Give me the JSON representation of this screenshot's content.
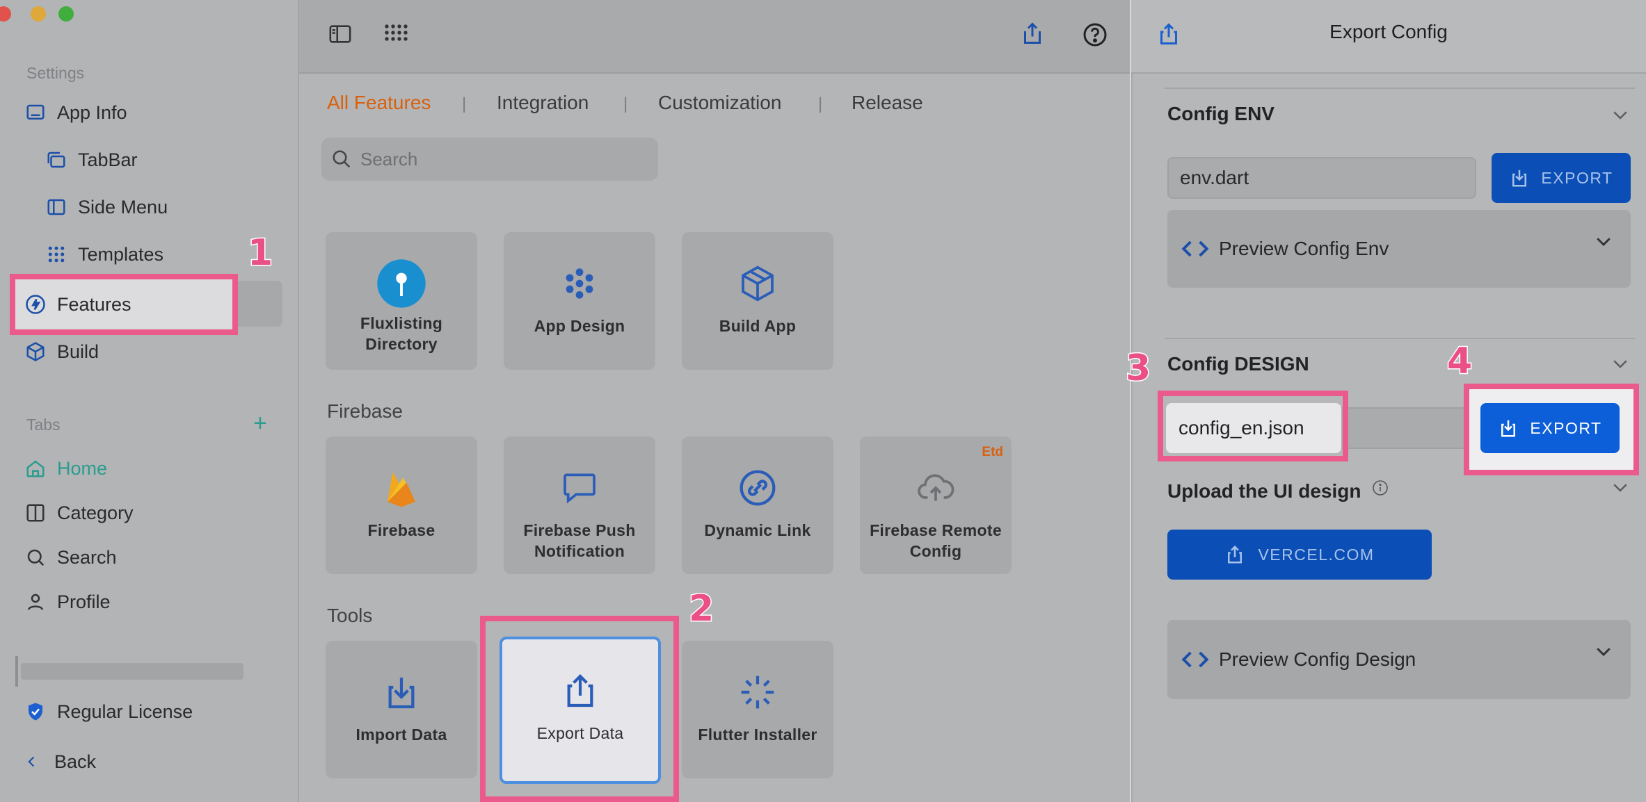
{
  "sidebar": {
    "settings_label": "Settings",
    "items": [
      {
        "label": "App Info",
        "icon": "monitor-icon"
      },
      {
        "label": "TabBar",
        "icon": "tabbar-icon"
      },
      {
        "label": "Side Menu",
        "icon": "side-menu-icon"
      },
      {
        "label": "Templates",
        "icon": "grid-icon"
      },
      {
        "label": "Features",
        "icon": "bolt-icon"
      },
      {
        "label": "Build",
        "icon": "cube-icon"
      }
    ],
    "tabs_label": "Tabs",
    "tabs": [
      {
        "label": "Home",
        "icon": "home-icon"
      },
      {
        "label": "Category",
        "icon": "columns-icon"
      },
      {
        "label": "Search",
        "icon": "search-icon"
      },
      {
        "label": "Profile",
        "icon": "user-icon"
      }
    ],
    "license": "Regular License",
    "back": "Back"
  },
  "main": {
    "tabs": [
      "All Features",
      "Integration",
      "Customization",
      "Release"
    ],
    "tab_separator": "|",
    "search_placeholder": "Search",
    "cards_top": [
      {
        "label": "Fluxlisting Directory",
        "icon": "pin-icon"
      },
      {
        "label": "App Design",
        "icon": "dots-icon"
      },
      {
        "label": "Build App",
        "icon": "box-icon"
      }
    ],
    "firebase_label": "Firebase",
    "cards_firebase": [
      {
        "label": "Firebase",
        "icon": "firebase-icon"
      },
      {
        "label": "Firebase Push Notification",
        "icon": "chat-icon"
      },
      {
        "label": "Dynamic Link",
        "icon": "link-icon"
      },
      {
        "label": "Firebase Remote Config",
        "icon": "cloud-upload-icon",
        "badge": "Etd"
      }
    ],
    "tools_label": "Tools",
    "cards_tools": [
      {
        "label": "Import Data",
        "icon": "import-icon"
      },
      {
        "label": "Export Data",
        "icon": "export-icon"
      },
      {
        "label": "Flutter Installer",
        "icon": "sparkle-icon"
      }
    ]
  },
  "panel": {
    "title": "Export Config",
    "env_title": "Config ENV",
    "env_field": "env.dart",
    "export_label": "EXPORT",
    "preview_env": "Preview Config Env",
    "design_title": "Config DESIGN",
    "design_field": "config_en.json",
    "upload_title": "Upload the UI design",
    "vercel_label": "VERCEL.COM",
    "preview_design": "Preview Config Design"
  },
  "annotations": [
    "1",
    "2",
    "3",
    "4"
  ],
  "colors": {
    "accent_blue": "#0d5fd9",
    "dark_blue": "#0b4fb6",
    "highlight_pink": "#ea5a8a",
    "active_orange": "#d9610e",
    "teal": "#2a9d8f"
  }
}
